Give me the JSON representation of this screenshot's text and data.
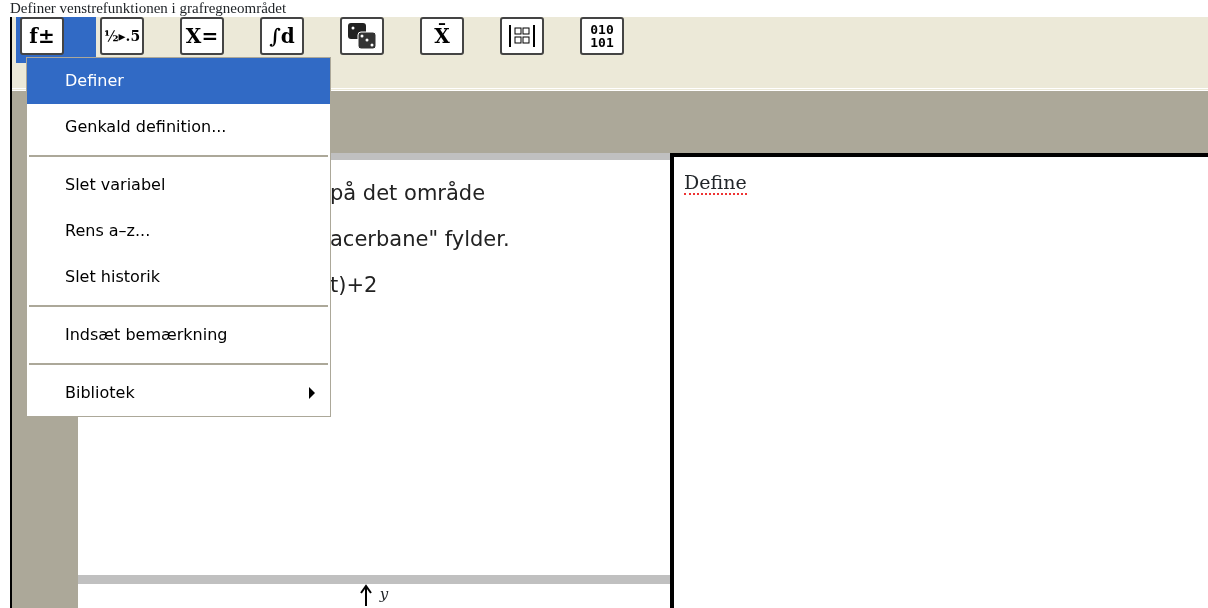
{
  "caption": "Definer venstrefunktionen i grafregneområdet",
  "toolbar": [
    {
      "kind": "text",
      "glyph": "f±",
      "selected": true
    },
    {
      "kind": "text",
      "glyph": "½▸.5",
      "selected": false
    },
    {
      "kind": "text",
      "glyph": "X=",
      "selected": false
    },
    {
      "kind": "text",
      "glyph": "∫d",
      "selected": false
    },
    {
      "kind": "dice",
      "selected": false
    },
    {
      "kind": "text",
      "glyph": "X̄",
      "selected": false
    },
    {
      "kind": "grid",
      "selected": false
    },
    {
      "kind": "lines",
      "lines": [
        "010",
        "101"
      ],
      "selected": false
    }
  ],
  "notes_lines": [
    "på det område",
    "acerbane\" fylder.",
    "t)+2"
  ],
  "graph_axis_label": "y",
  "calculator_entry": "Define",
  "menu": [
    {
      "kind": "item",
      "label": "Definer",
      "selected": true,
      "submenu": false
    },
    {
      "kind": "item",
      "label": "Genkald definition...",
      "selected": false,
      "submenu": false
    },
    {
      "kind": "separator"
    },
    {
      "kind": "item",
      "label": "Slet variabel",
      "selected": false,
      "submenu": false
    },
    {
      "kind": "item",
      "label": "Rens a–z...",
      "selected": false,
      "submenu": false
    },
    {
      "kind": "item",
      "label": "Slet historik",
      "selected": false,
      "submenu": false
    },
    {
      "kind": "separator"
    },
    {
      "kind": "item",
      "label": "Indsæt bemærkning",
      "selected": false,
      "submenu": false
    },
    {
      "kind": "separator"
    },
    {
      "kind": "item",
      "label": "Bibliotek",
      "selected": false,
      "submenu": true
    }
  ]
}
